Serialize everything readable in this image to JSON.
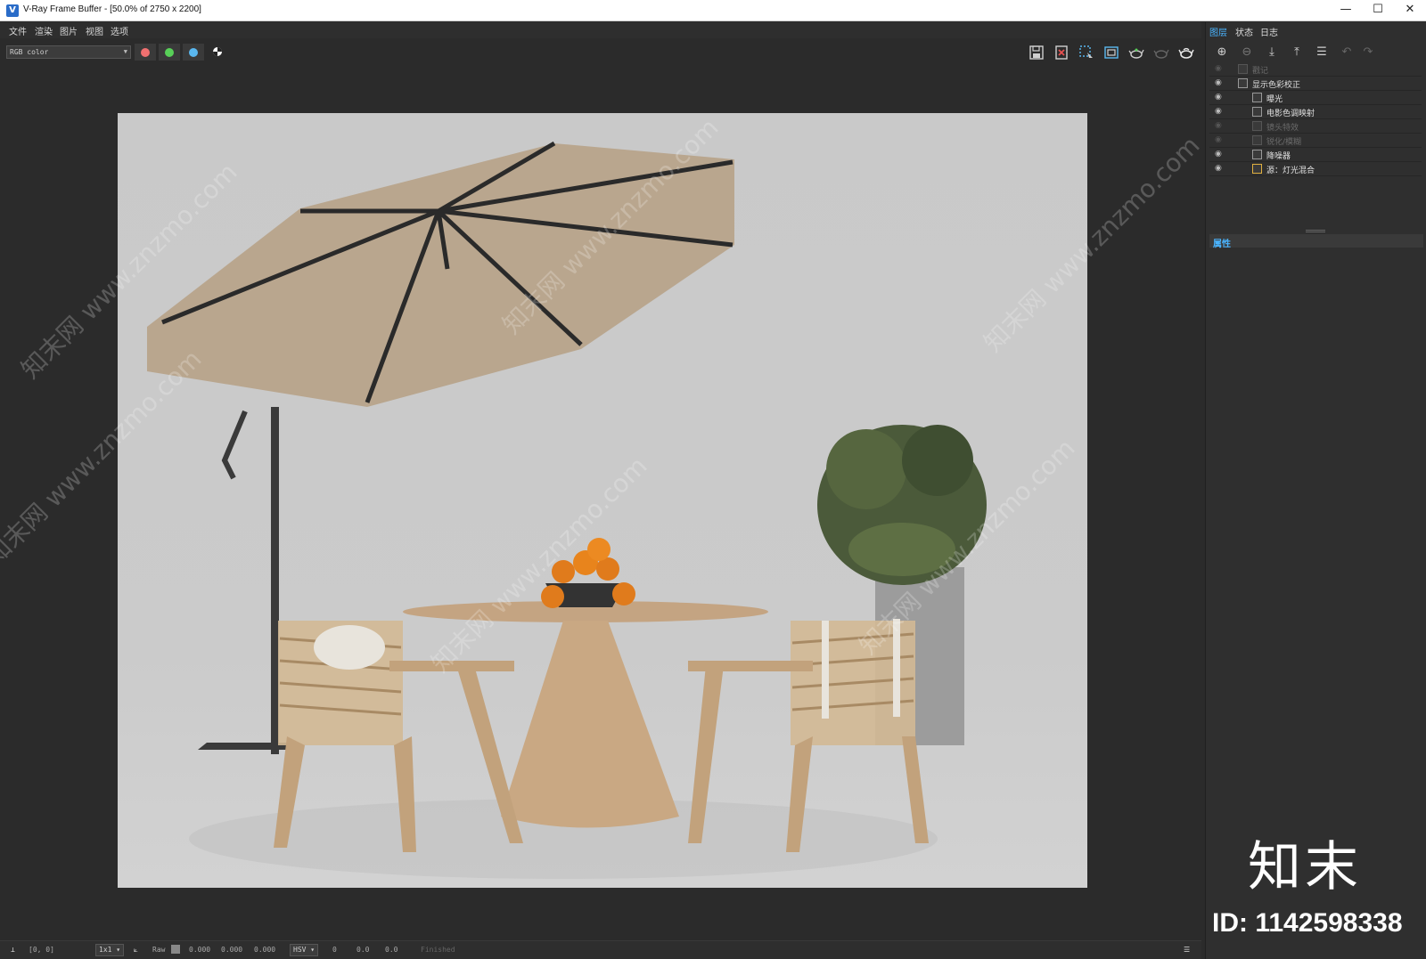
{
  "window": {
    "title": "V-Ray Frame Buffer - [50.0% of 2750 x 2200]",
    "app_icon": "V",
    "minimize": "—",
    "maximize": "☐",
    "close": "✕"
  },
  "menu": {
    "items": [
      {
        "label": "文件"
      },
      {
        "label": "渲染"
      },
      {
        "label": "图片"
      },
      {
        "label": "视图"
      },
      {
        "label": "选项"
      }
    ]
  },
  "toolbar": {
    "channel": "RGB color",
    "channel_colors": [
      "#f07070",
      "#58d058",
      "#5ab8f0"
    ],
    "icons": [
      "save-icon",
      "clear-icon",
      "region-icon",
      "follow-mouse-icon",
      "render-teapot-icon",
      "stop-render-icon",
      "interactive-render-icon"
    ]
  },
  "statusbar": {
    "coords": "[0, 0]",
    "zoom": "1x1",
    "raw_label": "Raw",
    "rgb": [
      "0.000",
      "0.000",
      "0.000"
    ],
    "color_mode": "HSV",
    "hsv": [
      "0",
      "0.0",
      "0.0"
    ],
    "state": "Finished"
  },
  "right_panel": {
    "tabs": [
      {
        "label": "图层",
        "active": true
      },
      {
        "label": "状态",
        "active": false
      },
      {
        "label": "日志",
        "active": false
      }
    ],
    "layers": [
      {
        "label": "戳记",
        "indent": 0,
        "enabled": false
      },
      {
        "label": "显示色彩校正",
        "indent": 0,
        "enabled": true
      },
      {
        "label": "曝光",
        "indent": 1,
        "enabled": true
      },
      {
        "label": "电影色调映射",
        "indent": 1,
        "enabled": true
      },
      {
        "label": "镜头特效",
        "indent": 1,
        "enabled": false
      },
      {
        "label": "锐化/模糊",
        "indent": 1,
        "enabled": false
      },
      {
        "label": "降噪器",
        "indent": 1,
        "enabled": true
      },
      {
        "label": "源：灯光混合",
        "indent": 1,
        "enabled": true
      }
    ],
    "properties_label": "属性"
  },
  "watermark": {
    "text": "知末网 www.znzmo.com",
    "brand": "知末",
    "id": "ID: 1142598338"
  },
  "colors": {
    "accent": "#4ab4ff",
    "background": "#2b2b2b",
    "umbrella": "#b9a68e"
  }
}
